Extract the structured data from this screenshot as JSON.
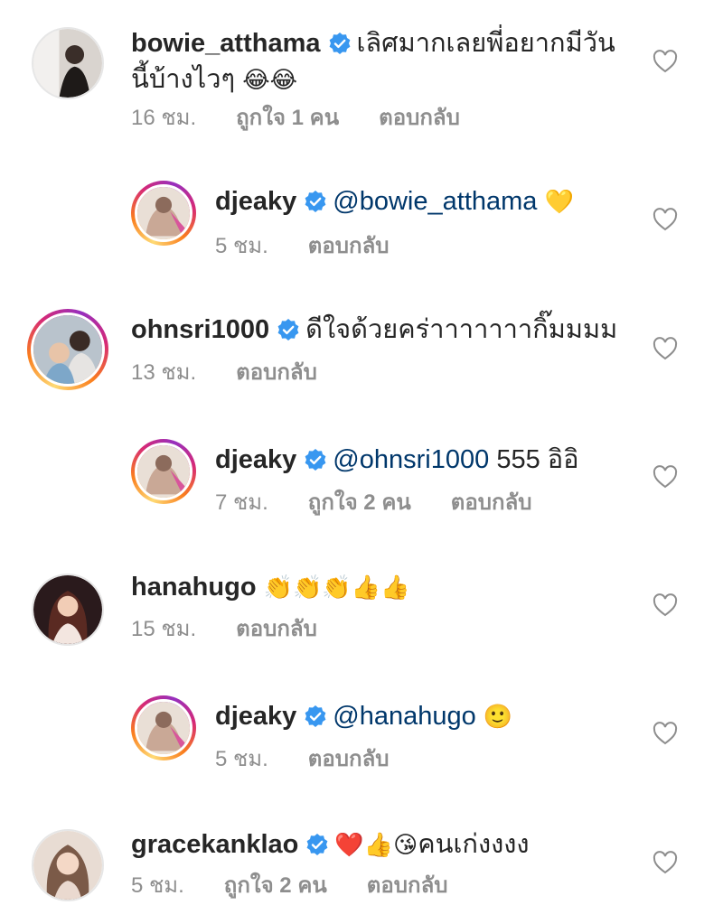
{
  "comments": [
    {
      "username": "bowie_atthama",
      "verified": true,
      "text": "เลิศมากเลยพี่อยากมีวัน",
      "text2": "นี้บ้างไวๆ",
      "emoji": "😂😂",
      "time": "16 ชม.",
      "likes": "ถูกใจ 1 คน",
      "reply": "ตอบกลับ"
    },
    {
      "username": "djeaky",
      "verified": true,
      "mention": "@bowie_atthama",
      "emoji": "💛",
      "time": "5 ชม.",
      "reply": "ตอบกลับ"
    },
    {
      "username": "ohnsri1000",
      "verified": true,
      "text": "ดีใจด้วยคร่าาาาาาากิ๊มมมม",
      "time": "13 ชม.",
      "reply": "ตอบกลับ"
    },
    {
      "username": "djeaky",
      "verified": true,
      "mention": "@ohnsri1000",
      "text": "555 อิอิ",
      "time": "7 ชม.",
      "likes": "ถูกใจ 2 คน",
      "reply": "ตอบกลับ"
    },
    {
      "username": "hanahugo",
      "verified": false,
      "emoji": "👏👏👏👍👍",
      "time": "15 ชม.",
      "reply": "ตอบกลับ"
    },
    {
      "username": "djeaky",
      "verified": true,
      "mention": "@hanahugo",
      "emoji": "🙂",
      "time": "5 ชม.",
      "reply": "ตอบกลับ"
    },
    {
      "username": "gracekanklao",
      "verified": true,
      "emoji": "❤️👍😘",
      "text": "คนเก่งงงง",
      "time": "5 ชม.",
      "likes": "ถูกใจ 2 คน",
      "reply": "ตอบกลับ"
    }
  ],
  "colors": {
    "verified": "#3897f0",
    "mention": "#00376b",
    "meta": "#8e8e8e",
    "ring_start": "#feda75",
    "ring_end": "#962fbf"
  },
  "icons": {
    "like": "heart-outline-icon",
    "verified": "verified-badge-icon"
  }
}
